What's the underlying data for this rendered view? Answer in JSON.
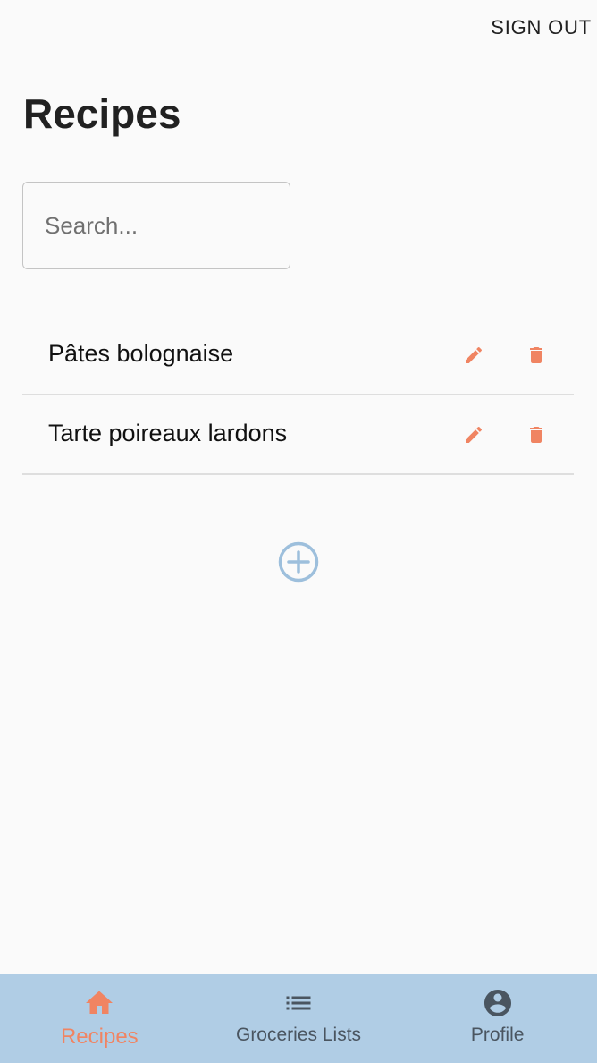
{
  "header": {
    "sign_out_label": "SIGN OUT",
    "title": "Recipes"
  },
  "search": {
    "placeholder": "Search...",
    "value": ""
  },
  "recipes": [
    {
      "name": "Pâtes bolognaise"
    },
    {
      "name": "Tarte poireaux lardons"
    }
  ],
  "icons": {
    "edit": "pencil-icon",
    "delete": "trash-icon",
    "add": "plus-circle-icon"
  },
  "bottom_nav": {
    "items": [
      {
        "label": "Recipes",
        "icon": "home-icon",
        "active": true
      },
      {
        "label": "Groceries Lists",
        "icon": "list-icon",
        "active": false
      },
      {
        "label": "Profile",
        "icon": "account-circle-icon",
        "active": false
      }
    ]
  },
  "colors": {
    "accent": "#f08462",
    "nav_background": "#b0cde5",
    "nav_inactive": "#4a5560",
    "add_button": "#9dbfdc",
    "background": "#fafafa"
  }
}
